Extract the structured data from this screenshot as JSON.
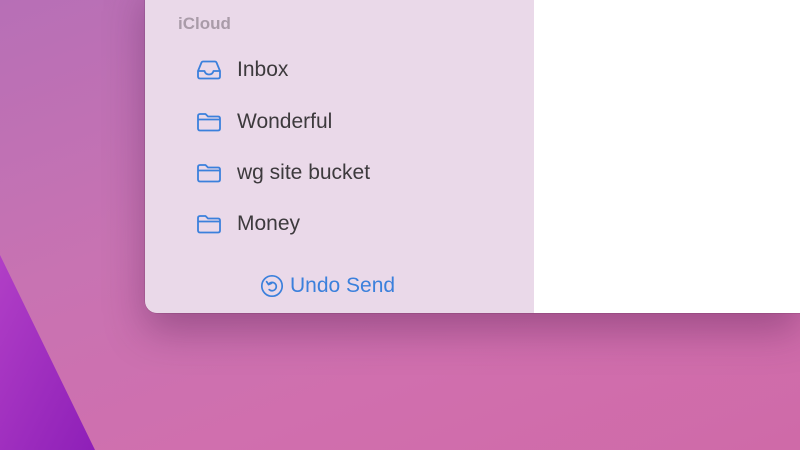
{
  "sidebar": {
    "section_label": "iCloud",
    "mailboxes": [
      {
        "label": "Inbox",
        "icon": "inbox-tray-icon"
      },
      {
        "label": "Wonderful",
        "icon": "folder-icon"
      },
      {
        "label": "wg site bucket",
        "icon": "folder-icon"
      },
      {
        "label": "Money",
        "icon": "folder-icon"
      }
    ],
    "undo_send": {
      "label": "Undo Send",
      "icon": "undo-arrow-icon"
    }
  },
  "colors": {
    "accent": "#3b80dc",
    "sidebar_bg": "#ead9e9",
    "section_label": "#a99ba8",
    "text": "#3d3a3d"
  }
}
